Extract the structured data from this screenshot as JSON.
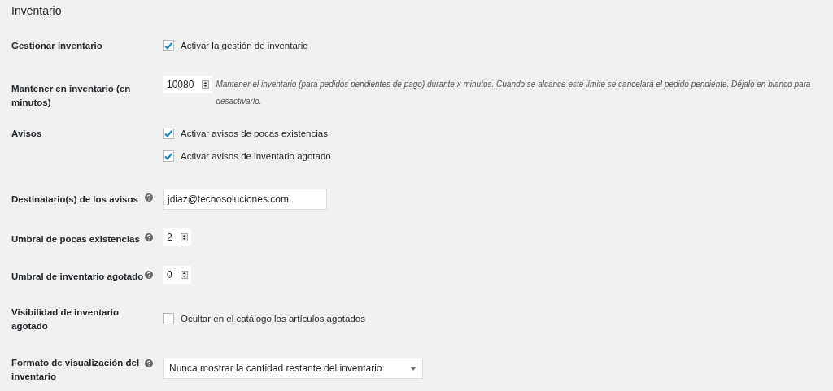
{
  "title": "Inventario",
  "rows": [
    {
      "label": "Gestionar inventario",
      "help": false,
      "kind": "checkboxes",
      "options": [
        {
          "label": "Activar la gestión de inventario",
          "checked": true
        }
      ]
    },
    {
      "label": "Mantener en inventario (en minutos)",
      "help": false,
      "kind": "number",
      "value": "10080",
      "description": "Mantener el inventario (para pedidos pendientes de pago) durante x minutos. Cuando se alcance este límite se cancelará el pedido pendiente. Déjalo en blanco para desactivarlo."
    },
    {
      "label": "Avisos",
      "help": false,
      "kind": "checkboxes",
      "options": [
        {
          "label": "Activar avisos de pocas existencias",
          "checked": true
        },
        {
          "label": "Activar avisos de inventario agotado",
          "checked": true
        }
      ]
    },
    {
      "label": "Destinatario(s) de los avisos",
      "help": true,
      "kind": "text",
      "value": "jdiaz@tecnosoluciones.com"
    },
    {
      "label": "Umbral de pocas existencias",
      "help": true,
      "kind": "number",
      "value": "2"
    },
    {
      "label": "Umbral de inventario agotado",
      "help": true,
      "kind": "number",
      "value": "0"
    },
    {
      "label": "Visibilidad de inventario agotado",
      "help": false,
      "kind": "checkboxes",
      "options": [
        {
          "label": "Ocultar en el catálogo los artículos agotados",
          "checked": false
        }
      ]
    },
    {
      "label": "Formato de visualización del inventario",
      "help": true,
      "kind": "select",
      "value": "Nunca mostrar la cantidad restante del inventario"
    }
  ]
}
